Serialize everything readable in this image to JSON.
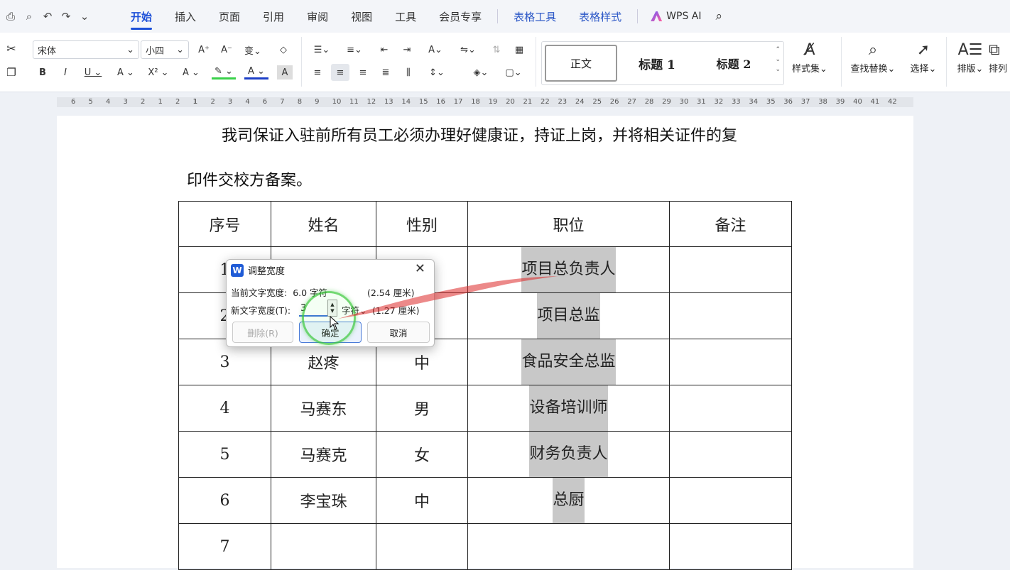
{
  "toolbar": {
    "quick_icons": [
      "print-icon",
      "print-preview-icon",
      "undo-icon",
      "redo-icon",
      "more-icon"
    ],
    "tabs": [
      "开始",
      "插入",
      "页面",
      "引用",
      "审阅",
      "视图",
      "工具",
      "会员专享",
      "表格工具",
      "表格样式"
    ],
    "wps_ai": "WPS AI"
  },
  "ribbon": {
    "font_name": "宋体",
    "font_size": "小四",
    "styles": [
      "正文",
      "标题 1",
      "标题 2"
    ],
    "style_set": "样式集",
    "find_replace": "查找替换",
    "select": "选择",
    "layout": "排版",
    "arrange": "排列"
  },
  "ruler": {
    "left_numbers": [
      "6",
      "5",
      "4",
      "3",
      "2",
      "1",
      "2",
      "1"
    ],
    "right_numbers": [
      "1",
      "2",
      "3",
      "4",
      "6",
      "7",
      "8",
      "9",
      "10",
      "11",
      "12",
      "13",
      "14",
      "15",
      "16",
      "17",
      "18",
      "19",
      "20",
      "21",
      "22",
      "23",
      "24",
      "25",
      "26",
      "27",
      "28",
      "29",
      "30",
      "31",
      "32",
      "33",
      "34",
      "35",
      "36",
      "37",
      "38",
      "39",
      "40",
      "41",
      "42"
    ]
  },
  "document": {
    "paragraph_line1": "我司保证入驻前所有员工必须办理好健康证，持证上岗，并将相关证件的复",
    "paragraph_line2": "印件交校方备案。",
    "table": {
      "headers": [
        "序号",
        "姓名",
        "性别",
        "职位",
        "备注"
      ],
      "rows": [
        [
          "1",
          "",
          "",
          "项目总负责人",
          ""
        ],
        [
          "2",
          "",
          "",
          "项目总监",
          ""
        ],
        [
          "3",
          "赵疼",
          "中",
          "食品安全总监",
          ""
        ],
        [
          "4",
          "马赛东",
          "男",
          "设备培训师",
          ""
        ],
        [
          "5",
          "马赛克",
          "女",
          "财务负责人",
          ""
        ],
        [
          "6",
          "李宝珠",
          "中",
          "总厨",
          ""
        ],
        [
          "7",
          "",
          "",
          "",
          ""
        ]
      ]
    }
  },
  "dialog": {
    "title": "调整宽度",
    "current_label": "当前文字宽度:",
    "current_value": "6.0 字符",
    "current_cm": "(2.54 厘米)",
    "new_label": "新文字宽度(T):",
    "new_value": "3",
    "unit": "字符",
    "new_cm": "(1.27 厘米)",
    "delete_btn": "删除(R)",
    "ok_btn": "确定",
    "cancel_btn": "取消",
    "close": "✕"
  },
  "colors": {
    "accent": "#1c4fd8",
    "highlight": "#c8c8c8",
    "circle": "#3cc83c"
  }
}
